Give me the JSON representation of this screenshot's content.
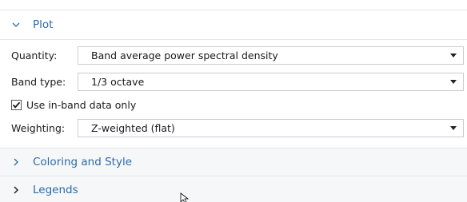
{
  "plot_section": {
    "title": "Plot",
    "expanded": true,
    "chevron_icon": "chevron-down-icon",
    "fields": {
      "quantity": {
        "label": "Quantity:",
        "value": "Band average power spectral density"
      },
      "band_type": {
        "label": "Band type:",
        "value": "1/3 octave"
      },
      "use_inband": {
        "label": "Use in-band data only",
        "checked": true
      },
      "weighting": {
        "label": "Weighting:",
        "value": "Z-weighted (flat)"
      }
    }
  },
  "coloring_section": {
    "title": "Coloring and Style",
    "expanded": false,
    "chevron_icon": "chevron-right-icon"
  },
  "legends_section": {
    "title": "Legends",
    "expanded": false,
    "chevron_icon": "chevron-right-icon"
  },
  "colors": {
    "section_title": "#2a6ba8",
    "border": "#c9ccd1"
  }
}
